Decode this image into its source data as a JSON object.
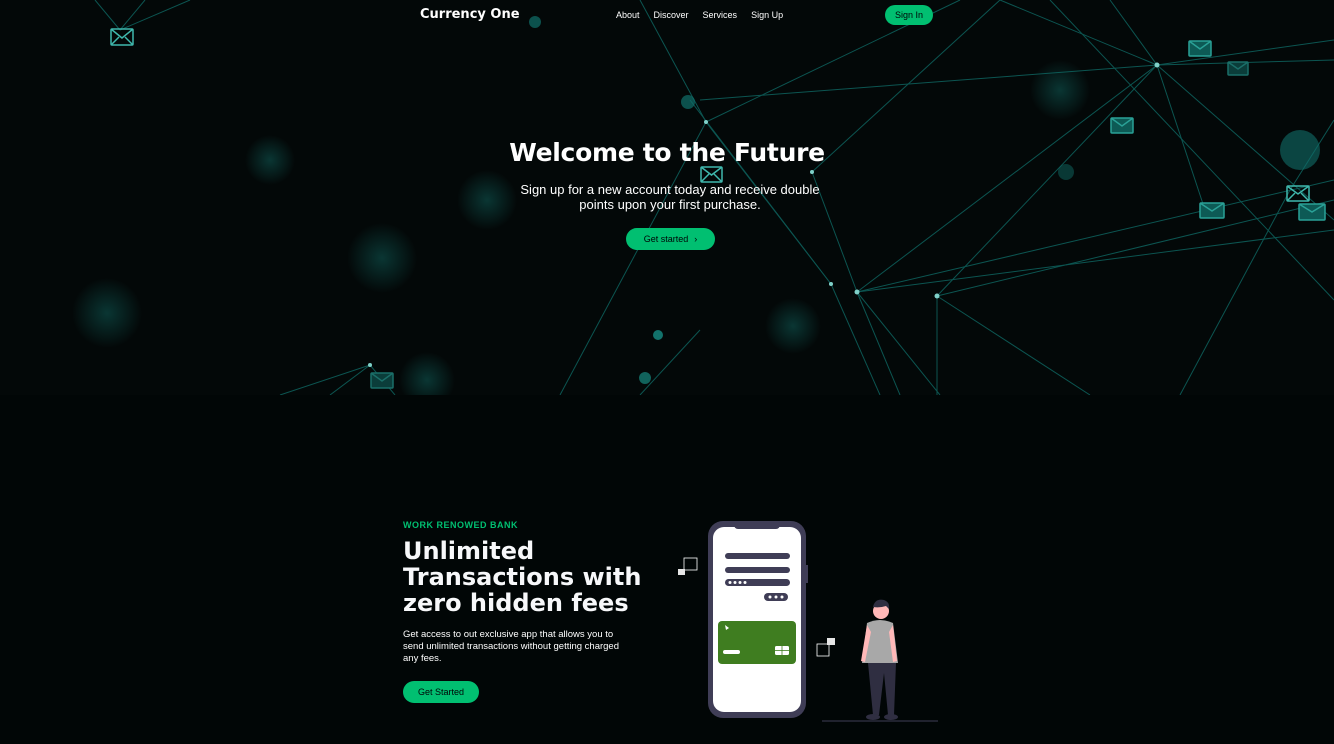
{
  "nav": {
    "logo": "Currency One",
    "links": [
      "About",
      "Discover",
      "Services",
      "Sign Up"
    ],
    "signin_label": "Sign In"
  },
  "hero": {
    "title": "Welcome to the Future",
    "subtitle": "Sign up for a new account today and receive double points upon your first purchase.",
    "button_label": "Get started",
    "button_icon": "chevron-right-icon"
  },
  "info": {
    "topline": "WORK RENOWED BANK",
    "heading": "Unlimited Transactions with zero hidden fees",
    "subtitle": "Get access to out exclusive app that allows you to send unlimited transactions without getting charged any fees.",
    "button_label": "Get Started"
  },
  "colors": {
    "accent": "#01bf71",
    "background": "#010606",
    "network_line": "#0f6f6a",
    "card_green": "#3f7d20",
    "phone_body": "#3f3d56"
  }
}
